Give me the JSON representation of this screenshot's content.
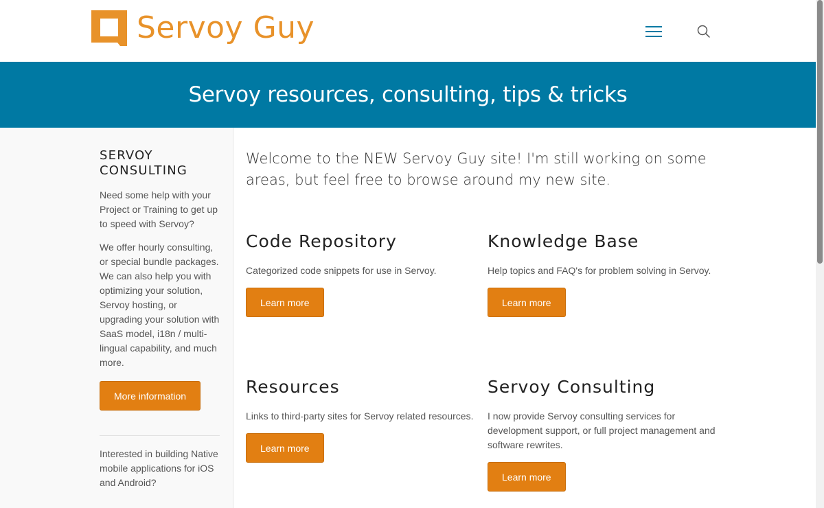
{
  "header": {
    "logo_text": "Servoy Guy",
    "brand_color": "#e8922a",
    "menu_icon": "hamburger-menu-icon",
    "search_icon": "search-icon"
  },
  "banner": {
    "tagline": "Servoy resources, consulting, tips & tricks",
    "background": "#0079a3"
  },
  "sidebar": {
    "title": "SERVOY CONSULTING",
    "text1": "Need some help with your Project or Training to get up to speed with Servoy?",
    "text2": "We offer hourly consulting, or special bundle packages.  We can also help you with optimizing your solution, Servoy hosting, or upgrading your solution with SaaS model, i18n / multi-lingual capability, and much more.",
    "button_label": "More information",
    "text3": "Interested in building Native mobile applications for iOS and Android?"
  },
  "main": {
    "welcome": "Welcome to the NEW Servoy Guy site! I'm still working on some areas, but feel free to browse around my new site.",
    "cards": [
      {
        "title": "Code Repository",
        "text": "Categorized code snippets for use in Servoy.",
        "button": "Learn more"
      },
      {
        "title": "Knowledge Base",
        "text": "Help topics and FAQ's for problem solving in Servoy.",
        "button": "Learn more"
      },
      {
        "title": "Resources",
        "text": "Links to third-party sites for Servoy related resources.",
        "button": "Learn more"
      },
      {
        "title": "Servoy Consulting",
        "text": "I now provide Servoy consulting services for development support, or full project management and software rewrites.",
        "button": "Learn more"
      }
    ]
  },
  "accent_color": "#e27f12"
}
